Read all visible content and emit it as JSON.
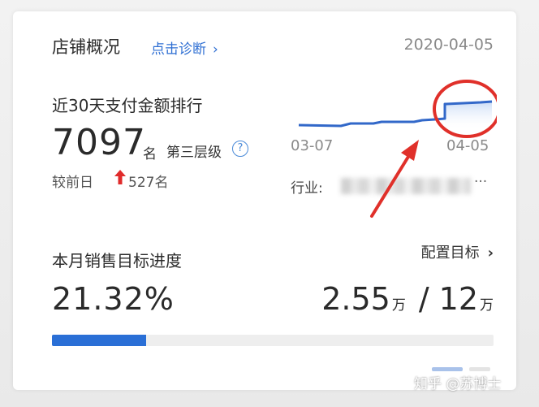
{
  "header": {
    "title": "店铺概况",
    "diagnose_link": "点击诊断",
    "date": "2020-04-05"
  },
  "ranking": {
    "title": "近30天支付金额排行",
    "rank": "7097",
    "unit": "名",
    "tier": "第三层级",
    "compare_label": "较前日",
    "compare_value": "527名",
    "trend_direction": "up",
    "x_start": "03-07",
    "x_end": "04-05",
    "industry_label": "行业:",
    "industry_suffix": "···",
    "colors": {
      "line": "#3268c9",
      "up": "#e02b2b"
    }
  },
  "target": {
    "title": "本月销售目标进度",
    "config_link": "配置目标",
    "percent": "21.32%",
    "progress_fraction": 0.2132,
    "achieved": "2.55",
    "achieved_unit": "万",
    "separator": "/",
    "goal": "12",
    "goal_unit": "万"
  },
  "watermark": "知乎 @苏博士",
  "colors": {
    "accent": "#2f6fd3",
    "progress_fill": "#2a6fd6",
    "annotation": "#e0302a"
  }
}
